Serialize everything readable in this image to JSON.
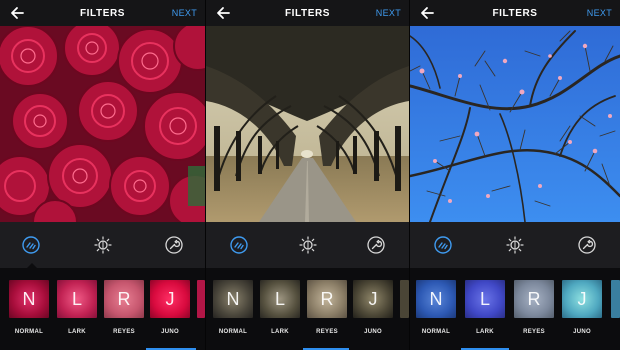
{
  "screens": [
    {
      "header": {
        "title": "FILTERS",
        "next_label": "NEXT"
      },
      "photo": "red peonies close-up",
      "tools": [
        "filter-icon",
        "brightness-icon",
        "wrench-icon"
      ],
      "filters": [
        {
          "name": "NORMAL",
          "letter": "N"
        },
        {
          "name": "LARK",
          "letter": "L"
        },
        {
          "name": "REYES",
          "letter": "R"
        },
        {
          "name": "JUNO",
          "letter": "J"
        }
      ],
      "selected_filter": "JUNO"
    },
    {
      "header": {
        "title": "FILTERS",
        "next_label": "NEXT"
      },
      "photo": "tree tunnel road",
      "tools": [
        "filter-icon",
        "brightness-icon",
        "wrench-icon"
      ],
      "filters": [
        {
          "name": "NORMAL",
          "letter": "N"
        },
        {
          "name": "LARK",
          "letter": "L"
        },
        {
          "name": "REYES",
          "letter": "R"
        },
        {
          "name": "JUNO",
          "letter": "J"
        }
      ],
      "selected_filter": "REYES"
    },
    {
      "header": {
        "title": "FILTERS",
        "next_label": "NEXT"
      },
      "photo": "blossoming branches against blue sky",
      "tools": [
        "filter-icon",
        "brightness-icon",
        "wrench-icon"
      ],
      "filters": [
        {
          "name": "NORMAL",
          "letter": "N"
        },
        {
          "name": "LARK",
          "letter": "L"
        },
        {
          "name": "REYES",
          "letter": "R"
        },
        {
          "name": "JUNO",
          "letter": "J"
        }
      ],
      "selected_filter": "LARK"
    }
  ],
  "colors": {
    "accent": "#3f9bf0",
    "selection": "#2f8fef",
    "bar": "#151517",
    "panel": "#1d1d20",
    "strip": "#0c0c0e"
  }
}
